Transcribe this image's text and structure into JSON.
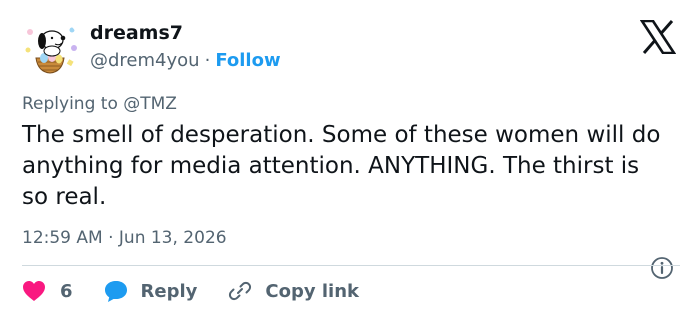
{
  "author": {
    "display_name": "dreams7",
    "handle": "@drem4you",
    "separator": "·",
    "follow_label": "Follow",
    "avatar_icon": "snoopy-easter-avatar-icon"
  },
  "platform_icon": "x-logo-icon",
  "reply_context": {
    "prefix": "Replying to",
    "mention": "@TMZ"
  },
  "tweet": {
    "text": "The smell of desperation. Some of these women will do anything for media attention. ANYTHING. The thirst is so real.",
    "timestamp": "12:59 AM · Jun 13, 2026"
  },
  "actions": {
    "like_count": "6",
    "reply_label": "Reply",
    "copy_label": "Copy link"
  },
  "colors": {
    "accent": "#1d9bf0",
    "like": "#f91880",
    "muted_text": "#536471",
    "primary_text": "#0f1419",
    "divider": "#cfd9de"
  }
}
